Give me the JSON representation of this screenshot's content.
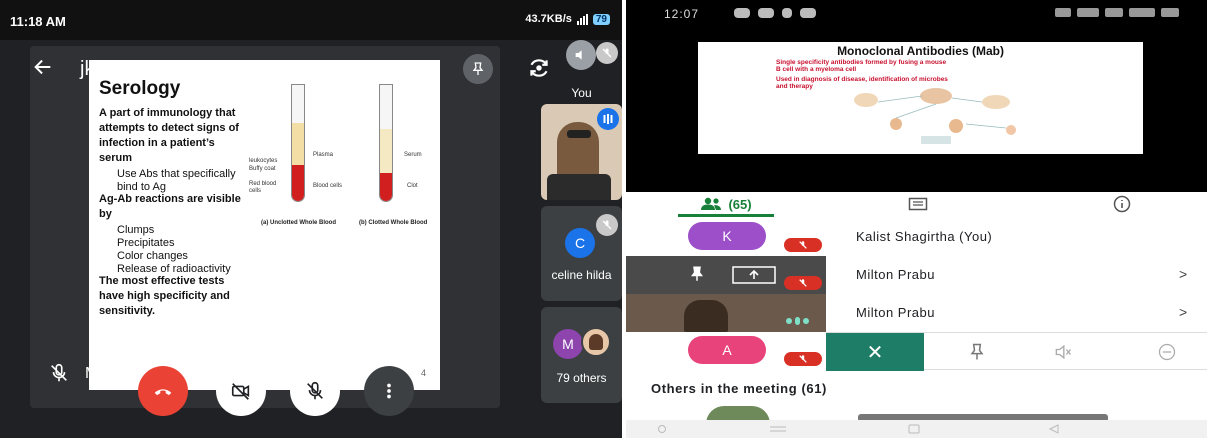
{
  "left": {
    "status": {
      "time": "11:18 AM",
      "net_speed": "43.7KB/s",
      "battery": "79"
    },
    "meeting_code": "jke-divw-kqb",
    "slide": {
      "title": "Serology",
      "lines": [
        {
          "style": "red",
          "text": "A part of immunology that"
        },
        {
          "style": "red",
          "text": "attempts to detect signs of"
        },
        {
          "style": "red",
          "text": "infection in a patient’s"
        },
        {
          "style": "red",
          "text": "serum"
        },
        {
          "style": "indent",
          "text": "Use Abs that specifically"
        },
        {
          "style": "indent",
          "text": "bind to Ag"
        },
        {
          "style": "red",
          "text": "Ag-Ab reactions are visible"
        },
        {
          "style": "red",
          "text": "by"
        },
        {
          "style": "indent",
          "text": "Clumps"
        },
        {
          "style": "indent",
          "text": "Precipitates"
        },
        {
          "style": "indent",
          "text": "Color changes"
        },
        {
          "style": "indent",
          "text": "Release of radioactivity"
        },
        {
          "style": "red",
          "text": "The most effective tests"
        },
        {
          "style": "red",
          "text": "have high specificity and"
        },
        {
          "style": "red",
          "text": "sensitivity."
        }
      ],
      "figure": {
        "labels_left": [
          "leukocytes",
          "Buffy coat",
          "Red blood",
          "cells"
        ],
        "label_plasma": "Plasma",
        "label_blood_cells": "Blood cells",
        "label_serum": "Serum",
        "label_clot": "Clot",
        "caption_a": "(a)  Unclotted Whole Blood",
        "caption_b": "(b)  Clotted Whole Blood"
      },
      "page_number": "4"
    },
    "presenter_name": "Milton",
    "tiles": {
      "you_label": "You",
      "celine_initial": "C",
      "celine_name": "celine hilda",
      "others_initial": "M",
      "others_label": "79 others"
    }
  },
  "right": {
    "status": {
      "time": "12:07"
    },
    "slide": {
      "title": "Monoclonal Antibodies (Mab)",
      "line1": "Single specificity antibodies formed by fusing a mouse",
      "line2": "B cell with a myeloma cell",
      "line3": "Used in diagnosis of disease, identification of microbes",
      "line4": "and therapy"
    },
    "tabs": {
      "people_count": "(65)"
    },
    "participants": [
      {
        "initial": "K",
        "name": "Kalist Shagirtha (You)",
        "color": "#9c4fc9"
      },
      {
        "name": "Milton Prabu"
      },
      {
        "name": "Milton Prabu"
      },
      {
        "initial": "A",
        "color": "#e8437a"
      }
    ],
    "others_heading": "Others in the meeting (61)"
  }
}
